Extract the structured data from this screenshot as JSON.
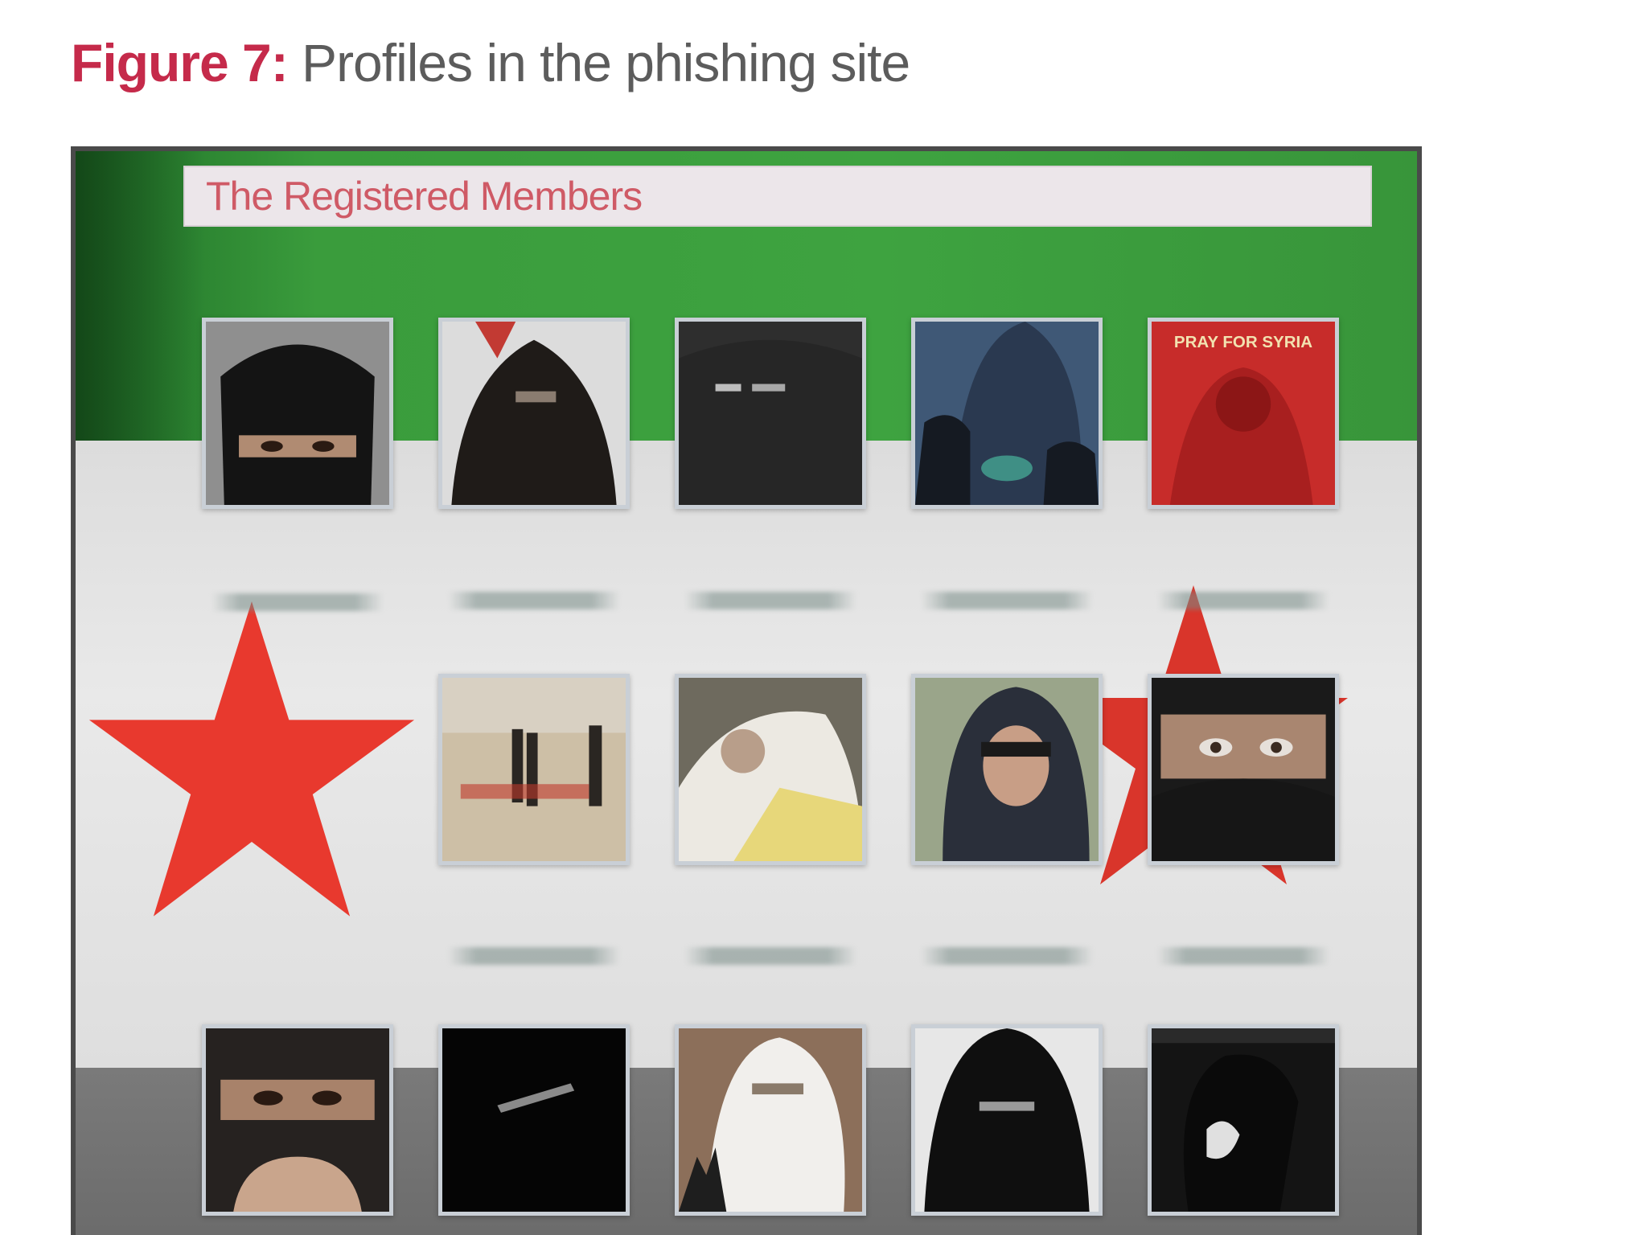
{
  "caption": {
    "figure_label": "Figure 7:",
    "text": "Profiles in the phishing site"
  },
  "site": {
    "title": "The Registered Members",
    "flag_colors": {
      "green": "#3ea340",
      "white": "#e6e6e6",
      "black_band": "#707070",
      "star_red": "#e8392e"
    },
    "member_rows": [
      {
        "profiles": [
          {
            "icon": "niqab-eyes-photo"
          },
          {
            "icon": "niqab-with-flag-photo"
          },
          {
            "icon": "dark-niqab-photo"
          },
          {
            "icon": "blue-niqab-group-photo"
          },
          {
            "icon": "pray-for-syria-poster",
            "poster_text": "PRAY FOR SYRIA"
          }
        ]
      },
      {
        "profiles": [
          {
            "icon": "desert-fighters-photo"
          },
          {
            "icon": "white-hijab-photo"
          },
          {
            "icon": "dark-hijab-photo"
          },
          {
            "icon": "niqab-closeup-photo"
          }
        ]
      },
      {
        "profiles": [
          {
            "icon": "niqab-hands-photo"
          },
          {
            "icon": "black-niqab-photo"
          },
          {
            "icon": "white-niqab-victory-photo"
          },
          {
            "icon": "black-niqab-standing-photo"
          },
          {
            "icon": "black-niqab-profile-photo"
          }
        ]
      }
    ]
  }
}
